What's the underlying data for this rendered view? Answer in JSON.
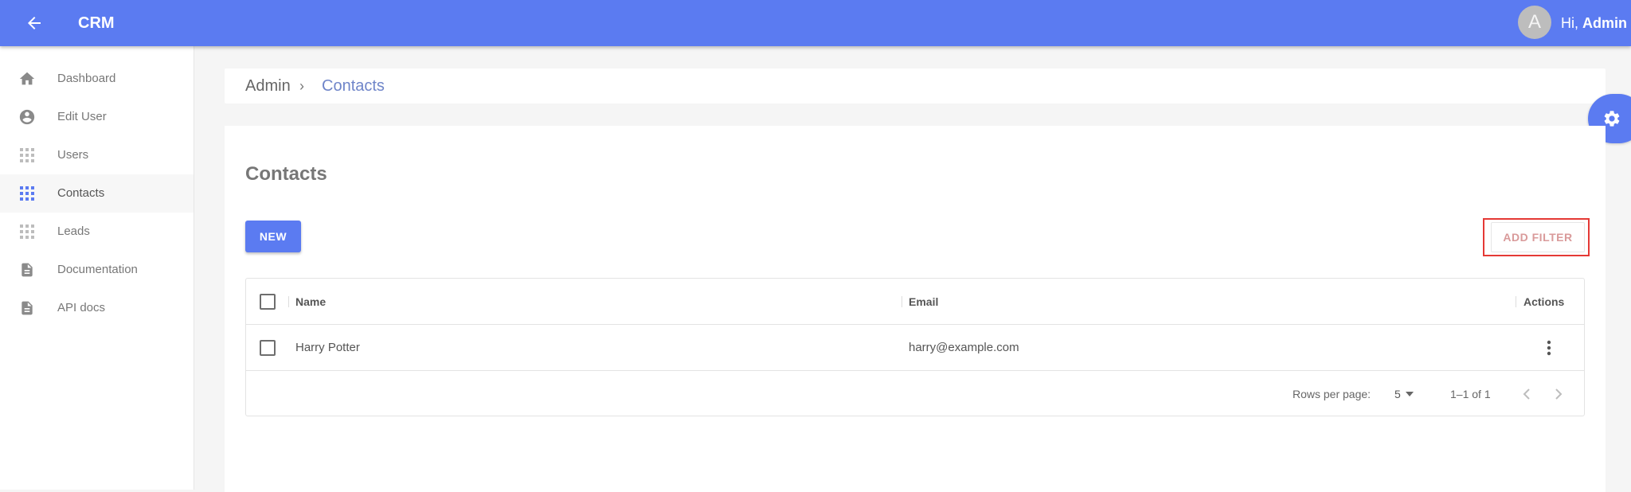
{
  "appbar": {
    "back_icon": "arrow-left-icon",
    "title": "CRM",
    "avatar_initial": "A",
    "greeting_prefix": "Hi, ",
    "greeting_name": "Admin",
    "color": "#5b7bf1"
  },
  "sidebar": {
    "items": [
      {
        "label": "Dashboard",
        "icon": "home-icon",
        "active": false
      },
      {
        "label": "Edit User",
        "icon": "account-circle-icon",
        "active": false
      },
      {
        "label": "Users",
        "icon": "grid-icon",
        "active": false
      },
      {
        "label": "Contacts",
        "icon": "grid-icon",
        "active": true
      },
      {
        "label": "Leads",
        "icon": "grid-icon",
        "active": false
      },
      {
        "label": "Documentation",
        "icon": "document-icon",
        "active": false
      },
      {
        "label": "API docs",
        "icon": "document-icon",
        "active": false
      }
    ]
  },
  "breadcrumb": {
    "root": "Admin",
    "separator": "›",
    "current": "Contacts"
  },
  "page": {
    "title": "Contacts",
    "new_button": "NEW",
    "add_filter_button": "ADD FILTER",
    "highlight_color": "#e53935"
  },
  "table": {
    "columns": [
      "Name",
      "Email",
      "Actions"
    ],
    "rows": [
      {
        "name": "Harry Potter",
        "email": "harry@example.com"
      }
    ]
  },
  "pagination": {
    "rows_per_page_label": "Rows per page:",
    "rows_per_page_value": "5",
    "range": "1–1 of 1"
  },
  "settings_fab_icon": "gear-icon"
}
